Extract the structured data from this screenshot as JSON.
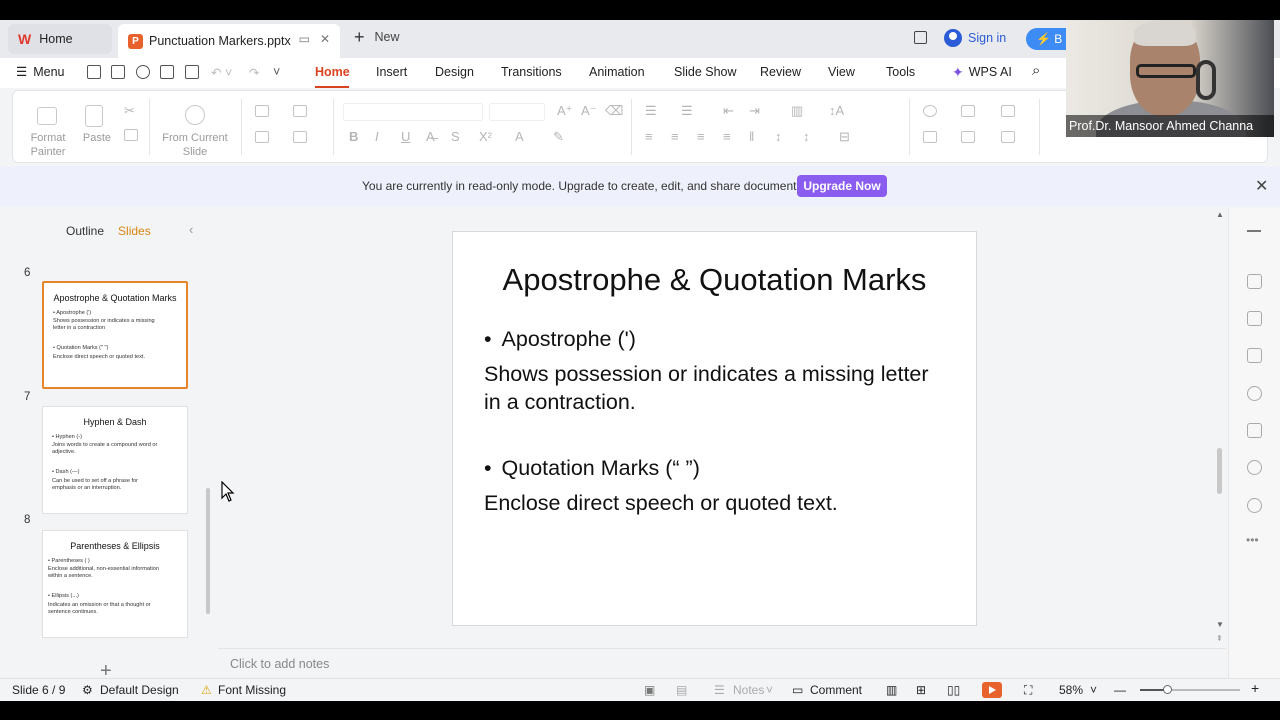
{
  "titlebar": {
    "home_tab": "Home",
    "file_tab": "Punctuation Markers.pptx",
    "new_tab": "New",
    "sign_in": "Sign in",
    "pill_letter": "B"
  },
  "menurow": {
    "menu": "Menu",
    "tabs": [
      "Home",
      "Insert",
      "Design",
      "Transitions",
      "Animation",
      "Slide Show",
      "Review",
      "View",
      "Tools"
    ],
    "wps_ai": "WPS AI"
  },
  "toolbar": {
    "format_painter": "Format\nPainter",
    "paste": "Paste",
    "from_current_slide": "From Current\nSlide"
  },
  "banner": {
    "text": "You are currently in read-only mode. Upgrade to create, edit, and share documents.",
    "button": "Upgrade Now"
  },
  "left_panel": {
    "outline_tab": "Outline",
    "slides_tab": "Slides",
    "thumbnails": [
      {
        "number": "6",
        "title": "Apostrophe & Quotation Marks",
        "lines": [
          "• Apostrophe (')",
          "Shows possession or indicates a missing\nletter in a contraction",
          "• Quotation Marks (\" \")",
          "Enclose direct speech or quoted text."
        ],
        "selected": true
      },
      {
        "number": "7",
        "title": "Hyphen & Dash",
        "lines": [
          "• Hyphen (-)",
          "Joins words to create a compound word or\nadjective.",
          "• Dash (—)",
          "Can be used to set off a phrase for\nemphasis or an interruption."
        ],
        "selected": false
      },
      {
        "number": "8",
        "title": "Parentheses & Ellipsis",
        "lines": [
          "• Parentheses ( )",
          "Enclose additional, non-essential information\nwithin a sentence.",
          "• Ellipsis (...)",
          "Indicates an omission or that a thought or\nsentence continues."
        ],
        "selected": false
      }
    ]
  },
  "slide": {
    "title": "Apostrophe & Quotation Marks",
    "bullet1": "Apostrophe (')",
    "body1": "Shows possession or indicates a missing letter in a contraction.",
    "bullet2": "Quotation Marks (“ ”)",
    "body2": "Enclose direct speech or quoted text."
  },
  "notes": {
    "placeholder": "Click to add notes"
  },
  "statusbar": {
    "slide_counter": "Slide 6 / 9",
    "design": "Default Design",
    "font_missing": "Font Missing",
    "notes": "Notes",
    "comment": "Comment",
    "zoom": "58%",
    "zoom_fraction": 0.28
  },
  "webcam": {
    "name": "Prof.Dr. Mansoor Ahmed Channa"
  },
  "colors": {
    "accent": "#d94420",
    "selection": "#e6842a",
    "upgrade": "#8a5cf0"
  }
}
